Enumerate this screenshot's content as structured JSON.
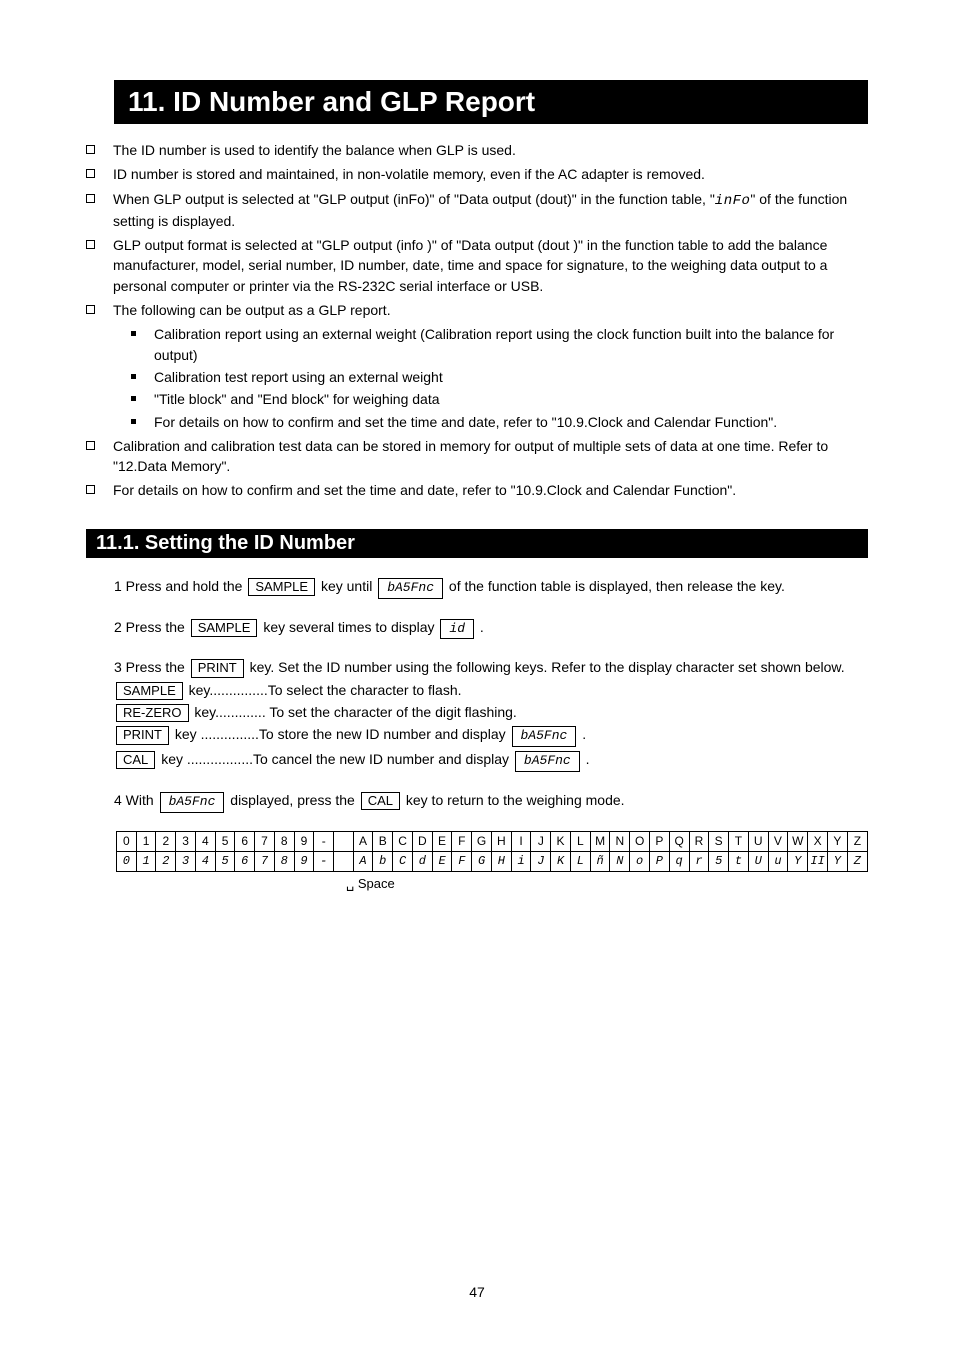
{
  "h1": "11.  ID Number and GLP Report",
  "bullets": [
    "The ID number is used to identify the balance when GLP is used.",
    "ID number is stored and maintained, in non-volatile memory, even if the AC adapter is removed.",
    "When GLP output is selected at \"GLP output (inFo)\" of \"Data output (dout)\" in the function table, \"",
    "\" of the function setting is displayed.",
    "GLP output format is selected at \"GLP output (info )\" of \"Data output (dout )\" in the function table to add the balance manufacturer, model, serial number, ID number, date, time and space for signature, to the weighing data output to a personal computer or printer via the RS-232C serial interface or USB.",
    "The following can be output as a GLP report."
  ],
  "subs": [
    "Calibration report using an external weight (Calibration report using the clock function built into the balance for output)",
    "Calibration test report using an external weight",
    "\"Title block\" and \"End block\" for weighing data",
    "For details on how to confirm and set the time and date, refer to \"10.9.Clock and Calendar Function\"."
  ],
  "bullets2": [
    "Calibration and calibration test data can be stored in memory for output of multiple sets of data at one time. Refer to \"12.Data Memory\".",
    "For details on how to confirm and set the time and date, refer to \"10.9.Clock and Calendar Function\"."
  ],
  "h2": "11.1. Setting the ID Number",
  "step1a": "1  Press and hold the ",
  "step1b": " key until ",
  "step1c": " of the function table is displayed, then release the key.",
  "step2a": "2  Press the ",
  "step2b": " key several times to display ",
  "step2c": " .",
  "step3a": "3  Press the ",
  "step3b": " key. Set the ID number using the following keys. Refer to the display character set shown below.",
  "step3_sample": "key...............To select the character to flash.",
  "step3_reZero": "key............. To set the character of the digit flashing.",
  "step3_print": "key ...............To store the new ID number and display ",
  "step3_cal": "key .................To cancel the new ID number and display ",
  "step4a": "4  With ",
  "step4b": " displayed, press the ",
  "step4c": " key to return to the weighing mode.",
  "keys": {
    "sample": "SAMPLE",
    "print": "PRINT",
    "rezero": "RE-ZERO",
    "cal": "CAL"
  },
  "disp": {
    "basfnc": "bA5Fnc",
    "id": "id",
    "info": "inFo"
  },
  "chart_data": {
    "type": "table",
    "title": "Display character set",
    "rows": [
      [
        "0",
        "1",
        "2",
        "3",
        "4",
        "5",
        "6",
        "7",
        "8",
        "9",
        "-",
        "",
        "A",
        "B",
        "C",
        "D",
        "E",
        "F",
        "G",
        "H",
        "I",
        "J",
        "K",
        "L",
        "M",
        "N",
        "O",
        "P",
        "Q",
        "R",
        "S",
        "T",
        "U",
        "V",
        "W",
        "X",
        "Y",
        "Z"
      ],
      [
        "0",
        "1",
        "2",
        "3",
        "4",
        "5",
        "6",
        "7",
        "8",
        "9",
        "-",
        "",
        "A",
        "b",
        "C",
        "d",
        "E",
        "F",
        "G",
        "H",
        "i",
        "J",
        "K",
        "L",
        "ñ",
        "N",
        "o",
        "P",
        "q",
        "r",
        "5",
        "t",
        "U",
        "u",
        "Y",
        "II",
        "Y",
        "Z"
      ]
    ],
    "space_label": "␣ Space"
  },
  "page": "47"
}
